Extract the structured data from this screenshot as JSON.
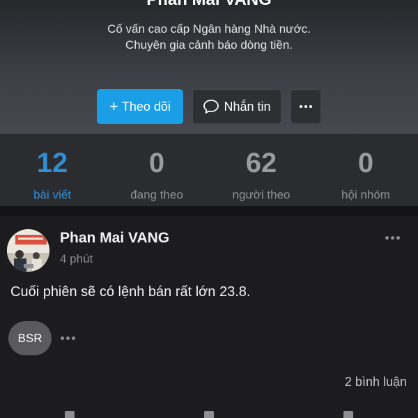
{
  "profile": {
    "name": "Phan Mai VANG",
    "bio_line1": "Cố vấn cao cấp Ngân hàng Nhà nước.",
    "bio_line2": "Chuyên gia cảnh báo dòng tiền."
  },
  "actions": {
    "follow_label": "Theo dõi",
    "follow_icon": "plus-icon",
    "message_label": "Nhắn tin",
    "message_icon": "chat-bubble-icon",
    "more_icon": "ellipsis-icon"
  },
  "stats": [
    {
      "value": "12",
      "label": "bài viết",
      "active": true
    },
    {
      "value": "0",
      "label": "đang theo",
      "active": false
    },
    {
      "value": "62",
      "label": "người theo",
      "active": false
    },
    {
      "value": "0",
      "label": "hội nhóm",
      "active": false
    }
  ],
  "post": {
    "author": "Phan Mai VANG",
    "time": "4 phút",
    "text": "Cuối phiên sẽ có lệnh bán rất lớn 23.8.",
    "tag": "BSR",
    "comments": "2 bình luận"
  },
  "colors": {
    "accent": "#1a9fe6",
    "active_stat": "#2f8fd6",
    "background": "#1c1c1e"
  }
}
